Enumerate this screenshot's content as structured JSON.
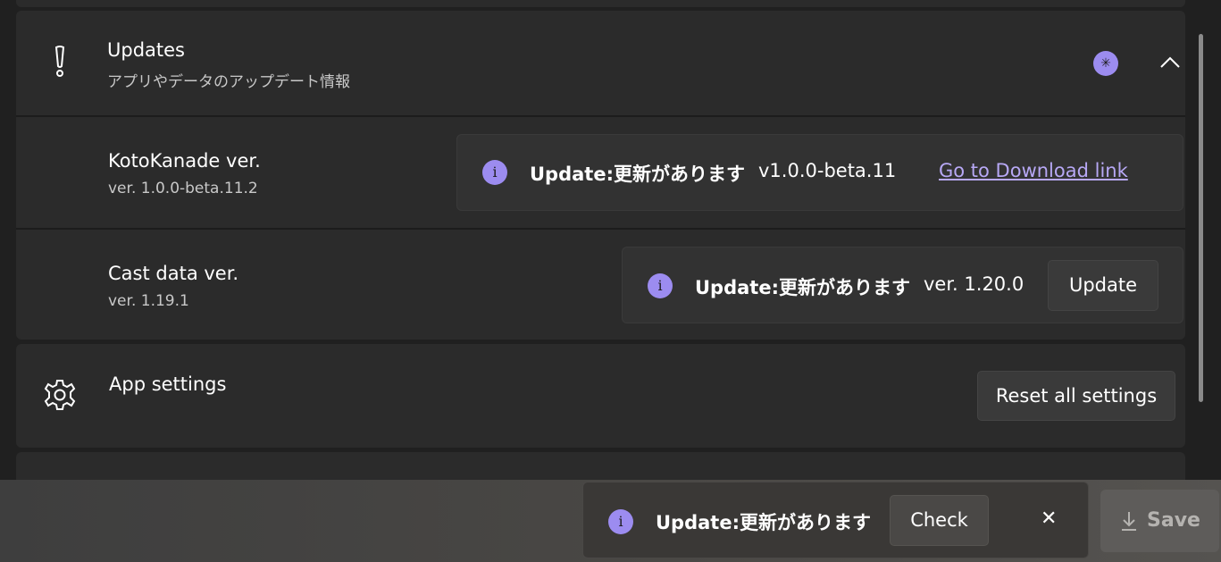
{
  "updates": {
    "title": "Updates",
    "subtitle": "アプリやデータのアップデート情報",
    "icon": "exclamation-icon",
    "badge_glyph": "✳",
    "collapse_glyph": "⌃"
  },
  "kotokanade": {
    "title": "KotoKanade ver.",
    "version": "ver. 1.0.0-beta.11.2",
    "info_title": "Update:更新があります",
    "info_message": "v1.0.0-beta.11",
    "link_label": "Go to Download link"
  },
  "castdata": {
    "title": "Cast data ver.",
    "version": "ver. 1.19.1",
    "info_title": "Update:更新があります",
    "info_message": "ver. 1.20.0",
    "button_label": "Update"
  },
  "app_settings": {
    "title": "App settings",
    "icon": "gear-icon",
    "button_label": "Reset all settings"
  },
  "bottom_bar": {
    "info_title": "Update:更新があります",
    "check_label": "Check",
    "close_glyph": "✕",
    "save_label": "Save",
    "save_icon": "download-arrow-icon"
  },
  "colors": {
    "accent": "#9c8cf0",
    "link": "#b7a8f5",
    "background": "#202020",
    "card": "#2b2b2b"
  },
  "info_glyph": "i"
}
